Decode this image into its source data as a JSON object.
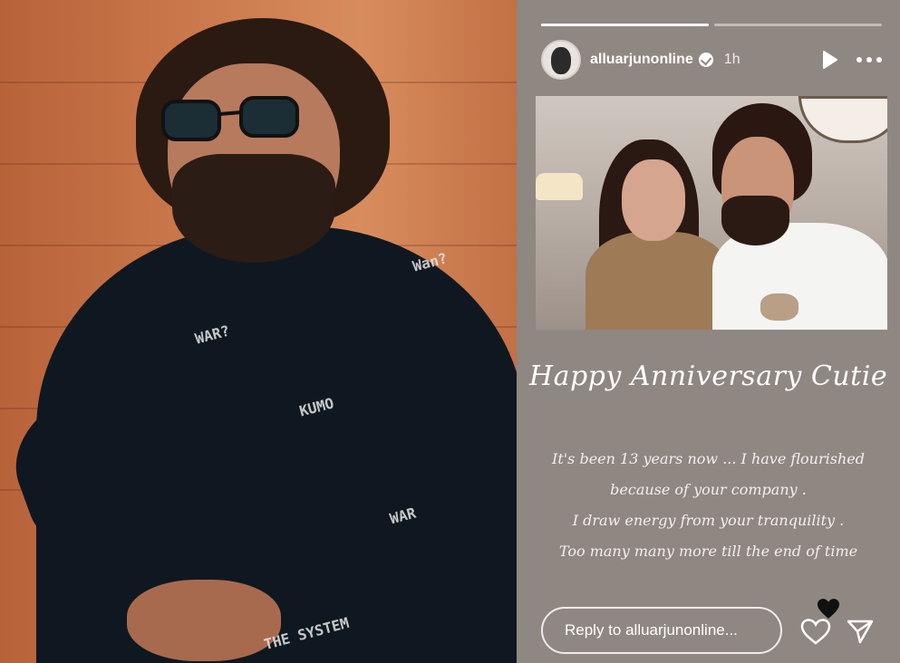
{
  "left_photo": {
    "description_icon": "person-photo",
    "shirt_prints": [
      "WAR?",
      "Wan?",
      "KUMO",
      "THE SYSTEM",
      "WAR"
    ]
  },
  "story": {
    "progress_bars": 2,
    "active_bar_index": 0,
    "username": "alluarjunonline",
    "verified": true,
    "timestamp": "1h",
    "photo_icon": "couple-photo",
    "title": "Happy Anniversary Cutie",
    "message_lines": [
      "It's been 13 years now ... I have flourished",
      "because of your company .",
      "I draw energy from your tranquility .",
      "Too many many more till the end of time"
    ],
    "reply_placeholder": "Reply to alluarjunonline...",
    "icons": {
      "play": "play-icon",
      "more": "more-options-icon",
      "like": "heart-icon",
      "send": "send-icon",
      "reaction": "black-heart-icon"
    }
  },
  "colors": {
    "story_background": "#8f8782",
    "text": "#ffffff"
  }
}
